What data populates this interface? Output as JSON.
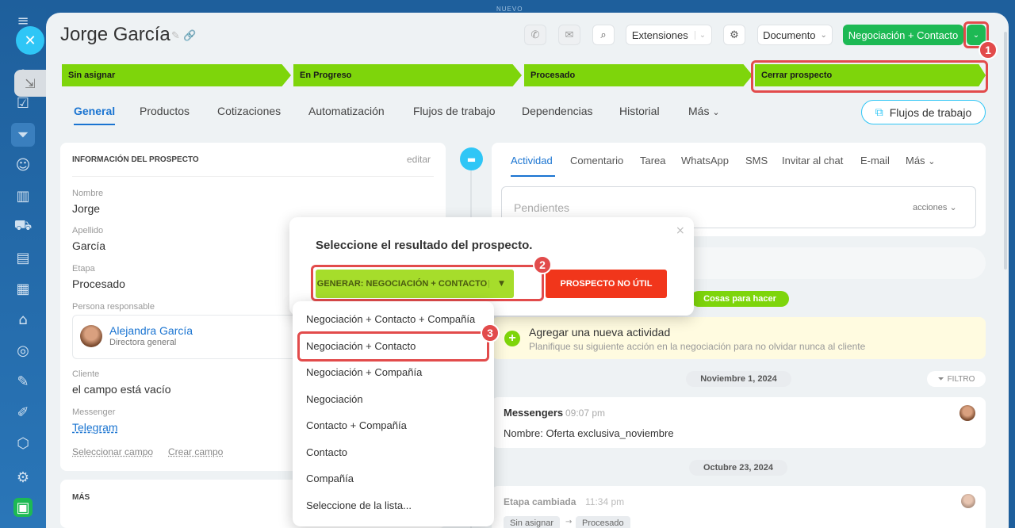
{
  "top_label": "NUEVO",
  "header": {
    "title": "Jorge García",
    "extensions_label": "Extensiones",
    "documento_label": "Documento",
    "convert_label": "Negociación + Contacto"
  },
  "stages": [
    "Sin asignar",
    "En Progreso",
    "Procesado",
    "Cerrar prospecto"
  ],
  "tabs": [
    "General",
    "Productos",
    "Cotizaciones",
    "Automatización",
    "Flujos de trabajo",
    "Dependencias",
    "Historial",
    "Más"
  ],
  "flows_button": "Flujos de trabajo",
  "info": {
    "section_title": "INFORMACIÓN DEL PROSPECTO",
    "edit_label": "editar",
    "name_label": "Nombre",
    "name_value": "Jorge",
    "surname_label": "Apellido",
    "surname_value": "García",
    "stage_label": "Etapa",
    "stage_value": "Procesado",
    "responsible_label": "Persona responsable",
    "responsible_name": "Alejandra García",
    "responsible_role": "Directora general",
    "client_label": "Cliente",
    "client_value": "el campo está vacío",
    "messenger_label": "Messenger",
    "messenger_value": "Telegram",
    "select_field": "Seleccionar campo",
    "create_field": "Crear campo",
    "more_section": "MÁS"
  },
  "activity": {
    "tabs": [
      "Actividad",
      "Comentario",
      "Tarea",
      "WhatsApp",
      "SMS",
      "Invitar al chat",
      "E-mail",
      "Más"
    ],
    "pending_placeholder": "Pendientes",
    "actions_label": "acciones",
    "todo_pill": "Cosas para hacer",
    "add_title": "Agregar una nueva actividad",
    "add_subtitle": "Planifique su siguiente acción en la negociación para no olvidar nunca al cliente",
    "date1": "Noviembre 1, 2024",
    "filter_label": "FILTRO",
    "msg_source": "Messengers",
    "msg_time": "09:07 pm",
    "msg_text": "Nombre: Oferta exclusiva_noviembre",
    "date2": "Octubre 23, 2024",
    "stage_change_title": "Etapa cambiada",
    "stage_change_time": "11:34 pm",
    "stage_from": "Sin asignar",
    "stage_to": "Procesado"
  },
  "popup": {
    "title": "Seleccione el resultado del prospecto.",
    "generate_label": "GENERAR: NEGOCIACIÓN + CONTACTO",
    "useless_label": "PROSPECTO NO ÚTIL"
  },
  "dropdown": [
    "Negociación + Contacto + Compañía",
    "Negociación + Contacto",
    "Negociación + Compañía",
    "Negociación",
    "Contacto + Compañía",
    "Contacto",
    "Compañía",
    "Seleccione de la lista..."
  ],
  "badges": [
    "1",
    "2",
    "3"
  ],
  "colors": {
    "accent": "#1a74d1",
    "stage_green": "#7ed50b",
    "convert_green": "#1db954",
    "highlight_red": "#e24b4b",
    "danger": "#f1361b"
  }
}
